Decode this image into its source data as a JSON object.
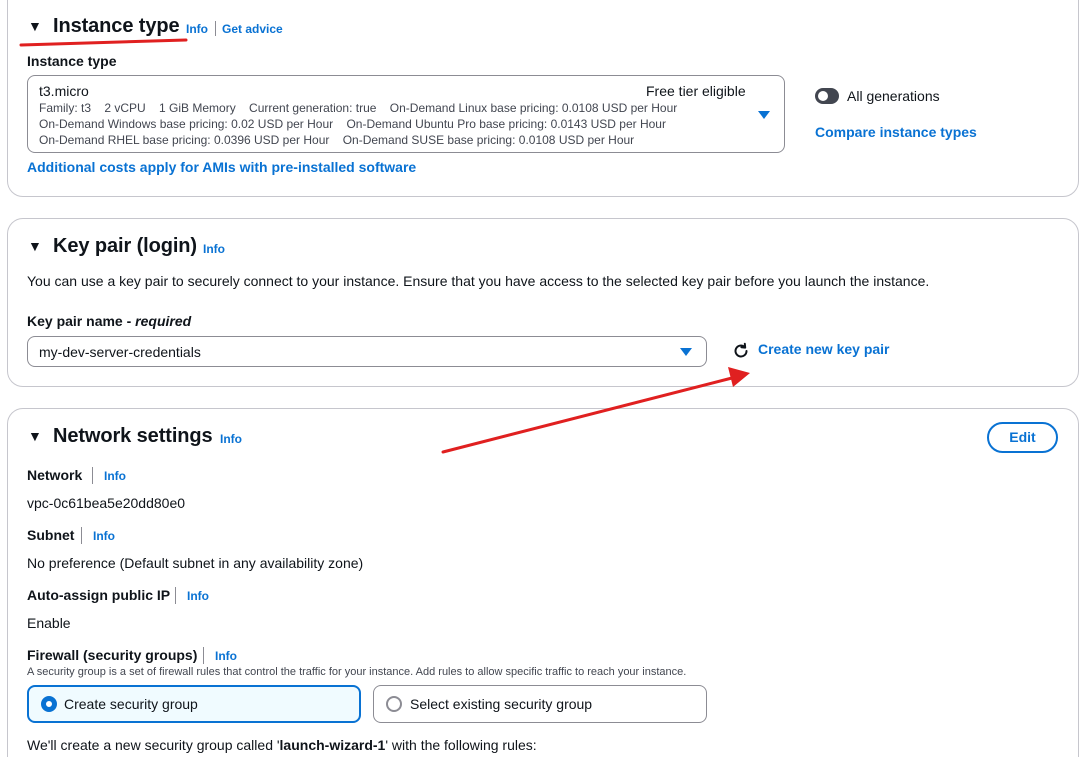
{
  "instance_type": {
    "title": "Instance type",
    "info": "Info",
    "get_advice": "Get advice",
    "field_label": "Instance type",
    "selected": {
      "name": "t3.micro",
      "badge": "Free tier eligible",
      "line1": "Family: t3    2 vCPU    1 GiB Memory    Current generation: true    On-Demand Linux base pricing: 0.0108 USD per Hour",
      "line2": "On-Demand Windows base pricing: 0.02 USD per Hour    On-Demand Ubuntu Pro base pricing: 0.0143 USD per Hour",
      "line3": "On-Demand RHEL base pricing: 0.0396 USD per Hour    On-Demand SUSE base pricing: 0.0108 USD per Hour"
    },
    "all_generations_label": "All generations",
    "compare_link": "Compare instance types",
    "additional_costs_link": "Additional costs apply for AMIs with pre-installed software"
  },
  "key_pair": {
    "title": "Key pair (login)",
    "info": "Info",
    "description": "You can use a key pair to securely connect to your instance. Ensure that you have access to the selected key pair before you launch the instance.",
    "field_label": "Key pair name - ",
    "field_required": "required",
    "selected_value": "my-dev-server-credentials",
    "create_link": "Create new key pair"
  },
  "network_settings": {
    "title": "Network settings",
    "info": "Info",
    "edit_button": "Edit",
    "network_label": "Network",
    "network_value": "vpc-0c61bea5e20dd80e0",
    "subnet_label": "Subnet",
    "subnet_value": "No preference (Default subnet in any availability zone)",
    "public_ip_label": "Auto-assign public IP",
    "public_ip_value": "Enable",
    "firewall_label": "Firewall (security groups)",
    "firewall_description": "A security group is a set of firewall rules that control the traffic for your instance. Add rules to allow specific traffic to reach your instance.",
    "option_create": "Create security group",
    "option_select": "Select existing security group",
    "new_group_prefix": "We'll create a new security group called '",
    "new_group_name": "launch-wizard-1",
    "new_group_suffix": "' with the following rules:"
  },
  "colors": {
    "link": "#0972d3",
    "annotation": "#e02020",
    "border": "#c6c6cd",
    "text": "#0f141a"
  }
}
